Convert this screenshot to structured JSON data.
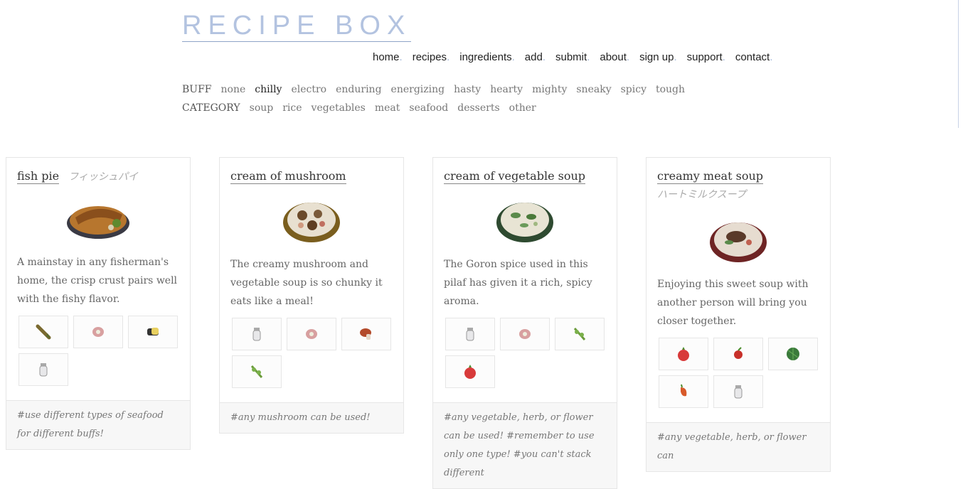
{
  "site": {
    "logo": "RECIPE BOX"
  },
  "nav": [
    {
      "label": "home",
      "dot": "."
    },
    {
      "label": "recipes",
      "dot": "."
    },
    {
      "label": "ingredients",
      "dot": "."
    },
    {
      "label": "add",
      "dot": "."
    },
    {
      "label": "submit",
      "dot": "."
    },
    {
      "label": "about",
      "dot": "."
    },
    {
      "label": "sign up",
      "dot": "."
    },
    {
      "label": "support",
      "dot": "."
    },
    {
      "label": "contact",
      "dot": "."
    }
  ],
  "filters": {
    "buff_label": "BUFF",
    "buffs": [
      "none",
      "chilly",
      "electro",
      "enduring",
      "energizing",
      "hasty",
      "hearty",
      "mighty",
      "sneaky",
      "spicy",
      "tough"
    ],
    "selected_buff": "chilly",
    "category_label": "CATEGORY",
    "categories": [
      "soup",
      "rice",
      "vegetables",
      "meat",
      "seafood",
      "desserts",
      "other"
    ]
  },
  "cards": [
    {
      "title": "fish pie",
      "jp": "フィッシュパイ",
      "desc": "A mainstay in any fisherman's home, the crisp crust pairs well with the fishy flavor.",
      "note": "#use different types of seafood for different buffs!",
      "bowl_color": "#6b5a3a"
    },
    {
      "title": "cream of mushroom",
      "desc": "The creamy mushroom and vegetable soup is so chunky it eats like a meal!",
      "note": "#any mushroom can be used!",
      "bowl_color": "#8a6a2a"
    },
    {
      "title": "cream of vegetable soup",
      "desc": "The Goron spice used in this pilaf has given it a rich, spicy aroma.",
      "note": "#any vegetable, herb, or flower can be used!  #remember to use only one type!  #you can't stack different",
      "bowl_color": "#3e5a3e"
    },
    {
      "title": "creamy meat soup",
      "jp": "ハートミルクスープ",
      "desc": "Enjoying this sweet soup with another person will bring you closer together.",
      "note": "#any vegetable, herb, or flower can",
      "bowl_color": "#7a2f2a"
    }
  ]
}
